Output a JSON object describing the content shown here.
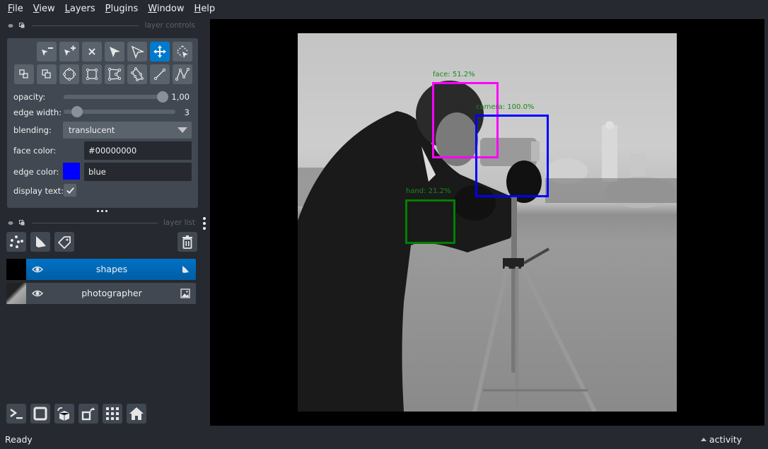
{
  "menubar": {
    "items": [
      "File",
      "View",
      "Layers",
      "Plugins",
      "Window",
      "Help"
    ]
  },
  "layer_controls": {
    "title": "layer controls",
    "tools_row1": [
      "remove-point",
      "add-point",
      "delete-shape",
      "select",
      "direct-select",
      "pan-zoom",
      "select-area"
    ],
    "tools_row2": [
      "move-back",
      "move-front",
      "ellipse",
      "rectangle",
      "polygon",
      "polygon-lasso",
      "line",
      "path"
    ],
    "active_tool": "pan-zoom",
    "opacity": {
      "label": "opacity:",
      "value": 1.0,
      "display": "1,00"
    },
    "edge_width": {
      "label": "edge width:",
      "value": 3,
      "display": "3"
    },
    "blending": {
      "label": "blending:",
      "value": "translucent"
    },
    "face_color": {
      "label": "face color:",
      "value": "#00000000"
    },
    "edge_color": {
      "label": "edge color:",
      "value": "blue",
      "swatch": "#0000ff"
    },
    "display_text": {
      "label": "display text:",
      "checked": true
    }
  },
  "layer_list": {
    "title": "layer list",
    "layers": [
      {
        "name": "shapes",
        "type": "shapes",
        "visible": true,
        "selected": true
      },
      {
        "name": "photographer",
        "type": "image",
        "visible": true,
        "selected": false
      }
    ]
  },
  "canvas": {
    "image": "photographer",
    "boxes": [
      {
        "label": "face: 51.2%",
        "class": "face",
        "score": 51.2,
        "color": "#ff00ff"
      },
      {
        "label": "camera: 100.0%",
        "class": "camera",
        "score": 100.0,
        "color": "#0000ff"
      },
      {
        "label": "hand: 21.2%",
        "class": "hand",
        "score": 21.2,
        "color": "#008000"
      }
    ],
    "label_color": "#1a8a1a"
  },
  "statusbar": {
    "status": "Ready",
    "activity": "activity"
  }
}
